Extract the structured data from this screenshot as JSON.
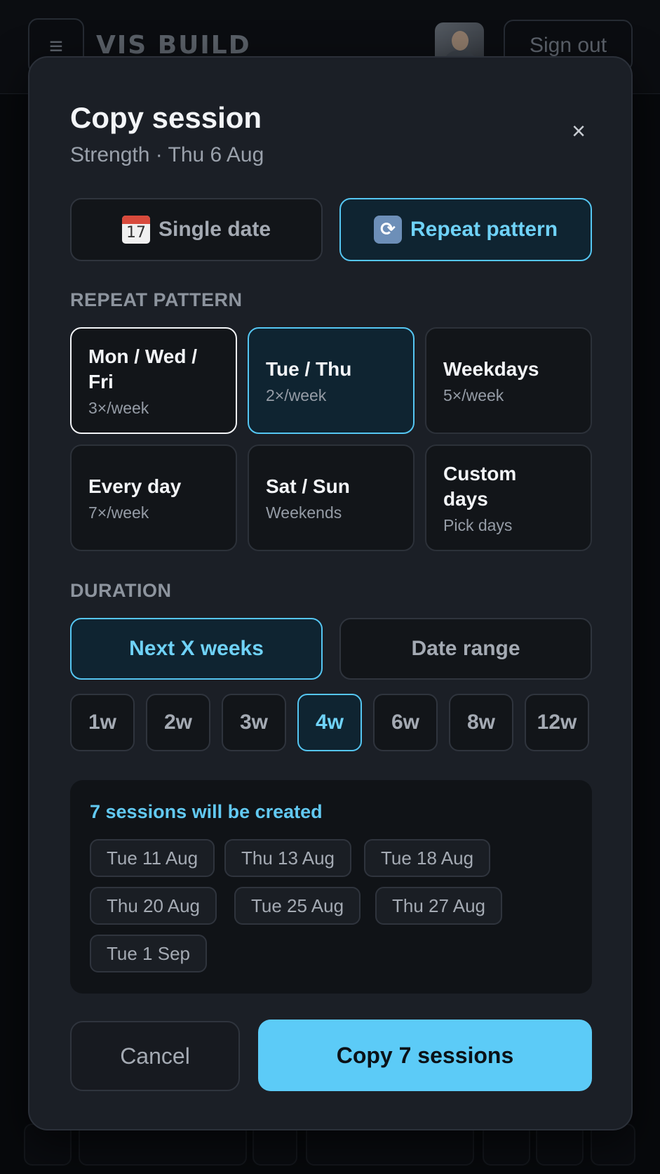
{
  "app": {
    "menu_icon": "hamburger-icon",
    "brand": "VIS BUILD",
    "sign_out": "Sign out"
  },
  "modal": {
    "title": "Copy session",
    "subtitle": "Strength · Thu 6 Aug",
    "close_label": "×",
    "modes": [
      {
        "label": "Single date",
        "icon": "calendar-icon",
        "icon_text": "17",
        "active": false
      },
      {
        "label": "Repeat pattern",
        "icon": "repeat-icon",
        "icon_text": "⟳",
        "active": true
      }
    ],
    "pattern_section_label": "REPEAT PATTERN",
    "patterns": [
      {
        "name": "Mon / Wed / Fri",
        "freq": "3×/week"
      },
      {
        "name": "Tue / Thu",
        "freq": "2×/week"
      },
      {
        "name": "Weekdays",
        "freq": "5×/week"
      },
      {
        "name": "Every day",
        "freq": "7×/week"
      },
      {
        "name": "Sat / Sun",
        "freq": "Weekends"
      },
      {
        "name": "Custom days",
        "freq": "Pick days"
      }
    ],
    "duration_section_label": "DURATION",
    "duration_modes": [
      "Next X weeks",
      "Date range"
    ],
    "weeks": [
      "1w",
      "2w",
      "3w",
      "4w",
      "6w",
      "8w",
      "12w"
    ],
    "selected_week": "4w",
    "preview_title": "7 sessions will be created",
    "preview_dates": [
      "Tue 11 Aug",
      "Thu 13 Aug",
      "Tue 18 Aug",
      "Thu 20 Aug",
      "Tue 25 Aug",
      "Thu 27 Aug",
      "Tue 1 Sep"
    ],
    "cancel_label": "Cancel",
    "confirm_label": "Copy 7 sessions"
  },
  "colors": {
    "accent": "#5ccbf7",
    "modal_bg": "#1b1f26",
    "page_bg": "#07090c"
  }
}
